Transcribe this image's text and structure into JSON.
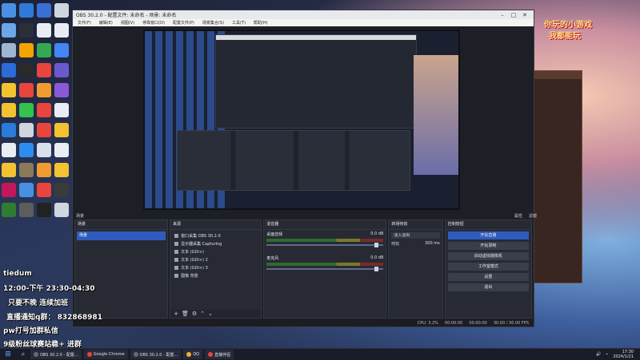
{
  "overlay": {
    "top_right_line1": "你玩的小游戏",
    "top_right_line2": "我都能玩",
    "schedule": "12:00-下午 23:30-04:30",
    "user_tag": "tiedum",
    "line_note": "只要不晚 连续加班",
    "qq_group_label": "直播通知q群：",
    "qq_group_number": "832868981",
    "pw_line": "pw打号加群私信",
    "bottom_line": "9级粉丝球赛站稳+ 进群"
  },
  "obs": {
    "title": "OBS 30.2.0 - 配置文件: 未命名 - 场景: 未命名",
    "menu": [
      "文件(F)",
      "编辑(E)",
      "视图(V)",
      "停靠窗口(D)",
      "配置文件(P)",
      "场景集合(S)",
      "工具(T)",
      "帮助(H)"
    ],
    "status_top": [
      "场景",
      "属性",
      "滤镜"
    ],
    "scenes": {
      "title": "场景",
      "items": [
        "场景"
      ]
    },
    "sources": {
      "title": "来源",
      "items": [
        "窗口采集 OBS 30.2.0",
        "显示器采集 Capturing",
        "文本 (GDI+)",
        "文本 (GDI+) 2",
        "文本 (GDI+) 3",
        "图像 背景"
      ]
    },
    "mixer": {
      "title": "混音器",
      "channels": [
        {
          "name": "桌面音频",
          "level": "0.0 dB"
        },
        {
          "name": "麦克风",
          "level": "0.0 dB"
        }
      ]
    },
    "transitions": {
      "title": "转场特效",
      "selected": "淡入淡出",
      "duration_label": "时长",
      "duration": "300 ms"
    },
    "controls": {
      "title": "控制按钮",
      "buttons": [
        "开始直播",
        "开始录制",
        "启动虚拟摄像机",
        "工作室模式",
        "设置",
        "退出"
      ]
    },
    "statusbar": [
      "CPU: 3.2%",
      "00:00:00",
      "00:00:00",
      "30.00 / 30.00 FPS"
    ]
  },
  "taskbar": {
    "apps": [
      {
        "label": "OBS 30.2.0 - 配置...",
        "color": "#6a6a6a"
      },
      {
        "label": "Google Chrome",
        "color": "#e8453c"
      },
      {
        "label": "OBS 30.2.0 - 配置...",
        "color": "#6a6a6a"
      },
      {
        "label": "QQ",
        "color": "#f2b02a"
      },
      {
        "label": "直播伴侣",
        "color": "#e8453c"
      }
    ],
    "time": "17:30",
    "date": "2024/1/21"
  },
  "colors": {
    "accent": "#2f5bbf",
    "obs_bg": "#1d1f26"
  }
}
